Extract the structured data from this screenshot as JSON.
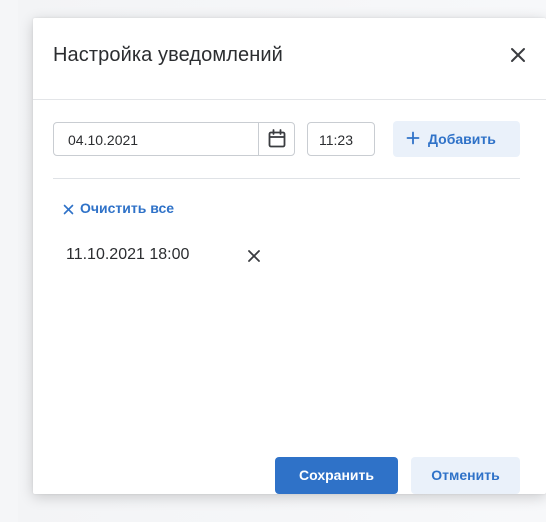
{
  "dialog": {
    "title": "Настройка уведомлений",
    "close_icon": "close-icon"
  },
  "form": {
    "date_value": "04.10.2021",
    "calendar_icon": "calendar-icon",
    "time_value": "11:23",
    "add_icon": "plus-icon",
    "add_label": "Добавить"
  },
  "notifications": {
    "clear_icon": "close-icon",
    "clear_all_label": "Очистить все",
    "items": [
      {
        "label": "11.10.2021 18:00",
        "remove_icon": "close-icon"
      }
    ]
  },
  "footer": {
    "save_label": "Сохранить",
    "cancel_label": "Отменить"
  },
  "colors": {
    "accent": "#2f72c8",
    "accent_light": "#eaf1fa",
    "text": "#2b2d30",
    "border": "#c9cdd2"
  }
}
